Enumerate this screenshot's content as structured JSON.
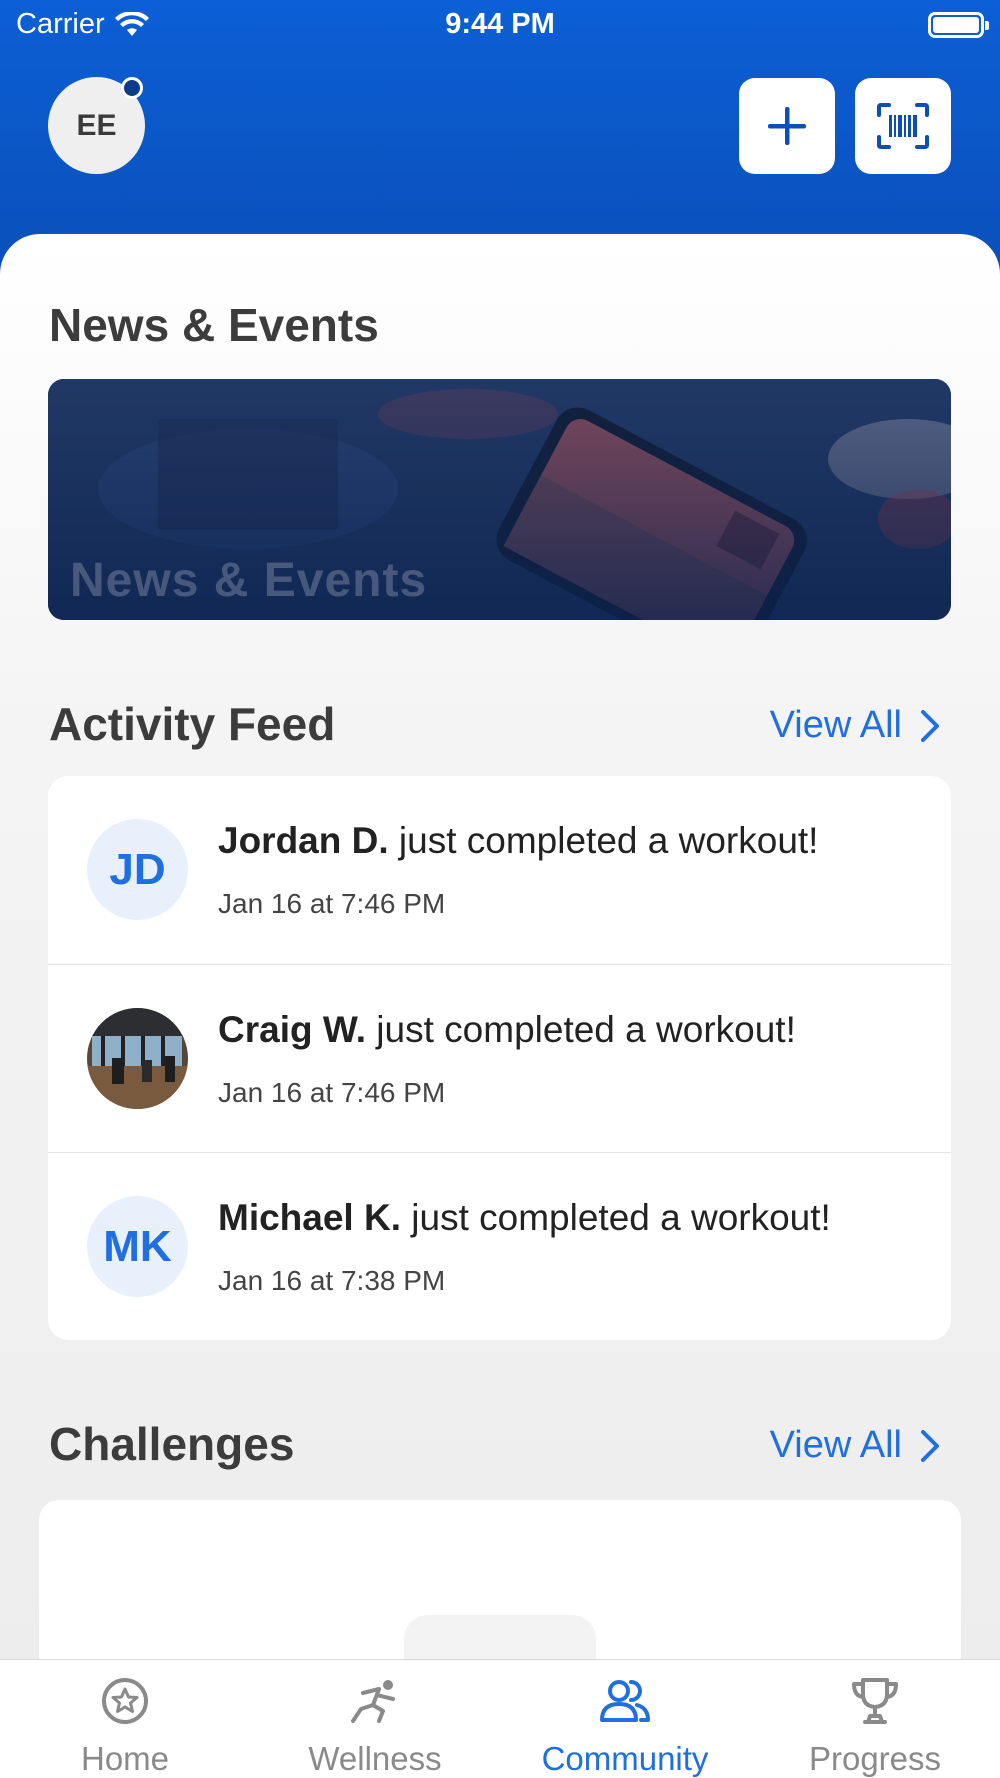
{
  "status_bar": {
    "carrier": "Carrier",
    "time": "9:44 PM"
  },
  "header": {
    "avatar_initials": "EE",
    "add_icon": "plus-icon",
    "scan_icon": "barcode-scan-icon",
    "accent": "#0c5fd6"
  },
  "news": {
    "title": "News & Events",
    "card_title": "News & Events"
  },
  "activity_feed": {
    "title": "Activity Feed",
    "view_all": "View All",
    "items": [
      {
        "initials": "JD",
        "name": "Jordan D.",
        "action": " just completed a workout!",
        "time": "Jan 16 at 7:46 PM"
      },
      {
        "initials": "",
        "name": "Craig W.",
        "action": " just completed a workout!",
        "time": "Jan 16 at 7:46 PM"
      },
      {
        "initials": "MK",
        "name": "Michael K.",
        "action": " just completed a workout!",
        "time": "Jan 16 at 7:38 PM"
      }
    ]
  },
  "challenges": {
    "title": "Challenges",
    "view_all": "View All"
  },
  "tabbar": {
    "tabs": [
      {
        "label": "Home",
        "icon": "star-circle-icon"
      },
      {
        "label": "Wellness",
        "icon": "runner-icon"
      },
      {
        "label": "Community",
        "icon": "people-icon"
      },
      {
        "label": "Progress",
        "icon": "trophy-icon"
      }
    ],
    "active": "Community",
    "active_color": "#1f6fe0",
    "inactive_color": "#8a8a8a"
  }
}
